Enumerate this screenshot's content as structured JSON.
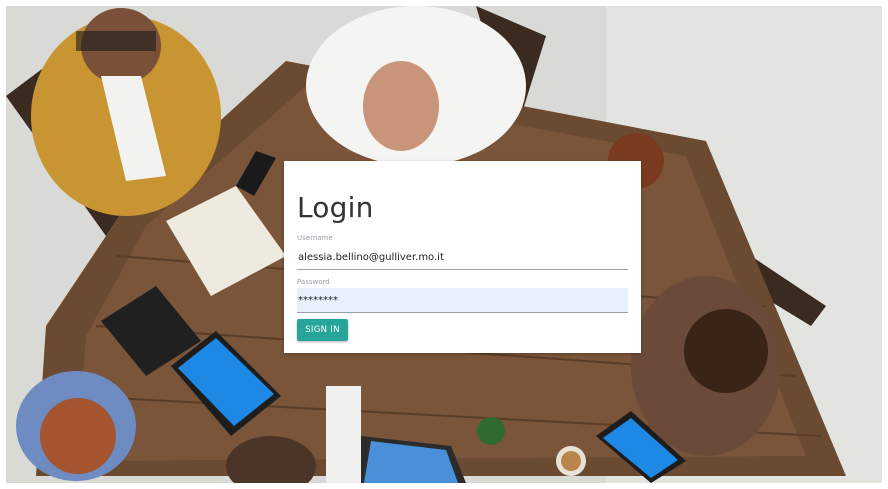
{
  "login": {
    "title": "Login",
    "username_label": "Username",
    "username_value": "alessia.bellino@gulliver.mo.it",
    "password_label": "Password",
    "password_value": "********",
    "sign_in_label": "SIGN IN"
  },
  "colors": {
    "button": "#26a69a",
    "password_autofill_bg": "#e8f0fe"
  }
}
